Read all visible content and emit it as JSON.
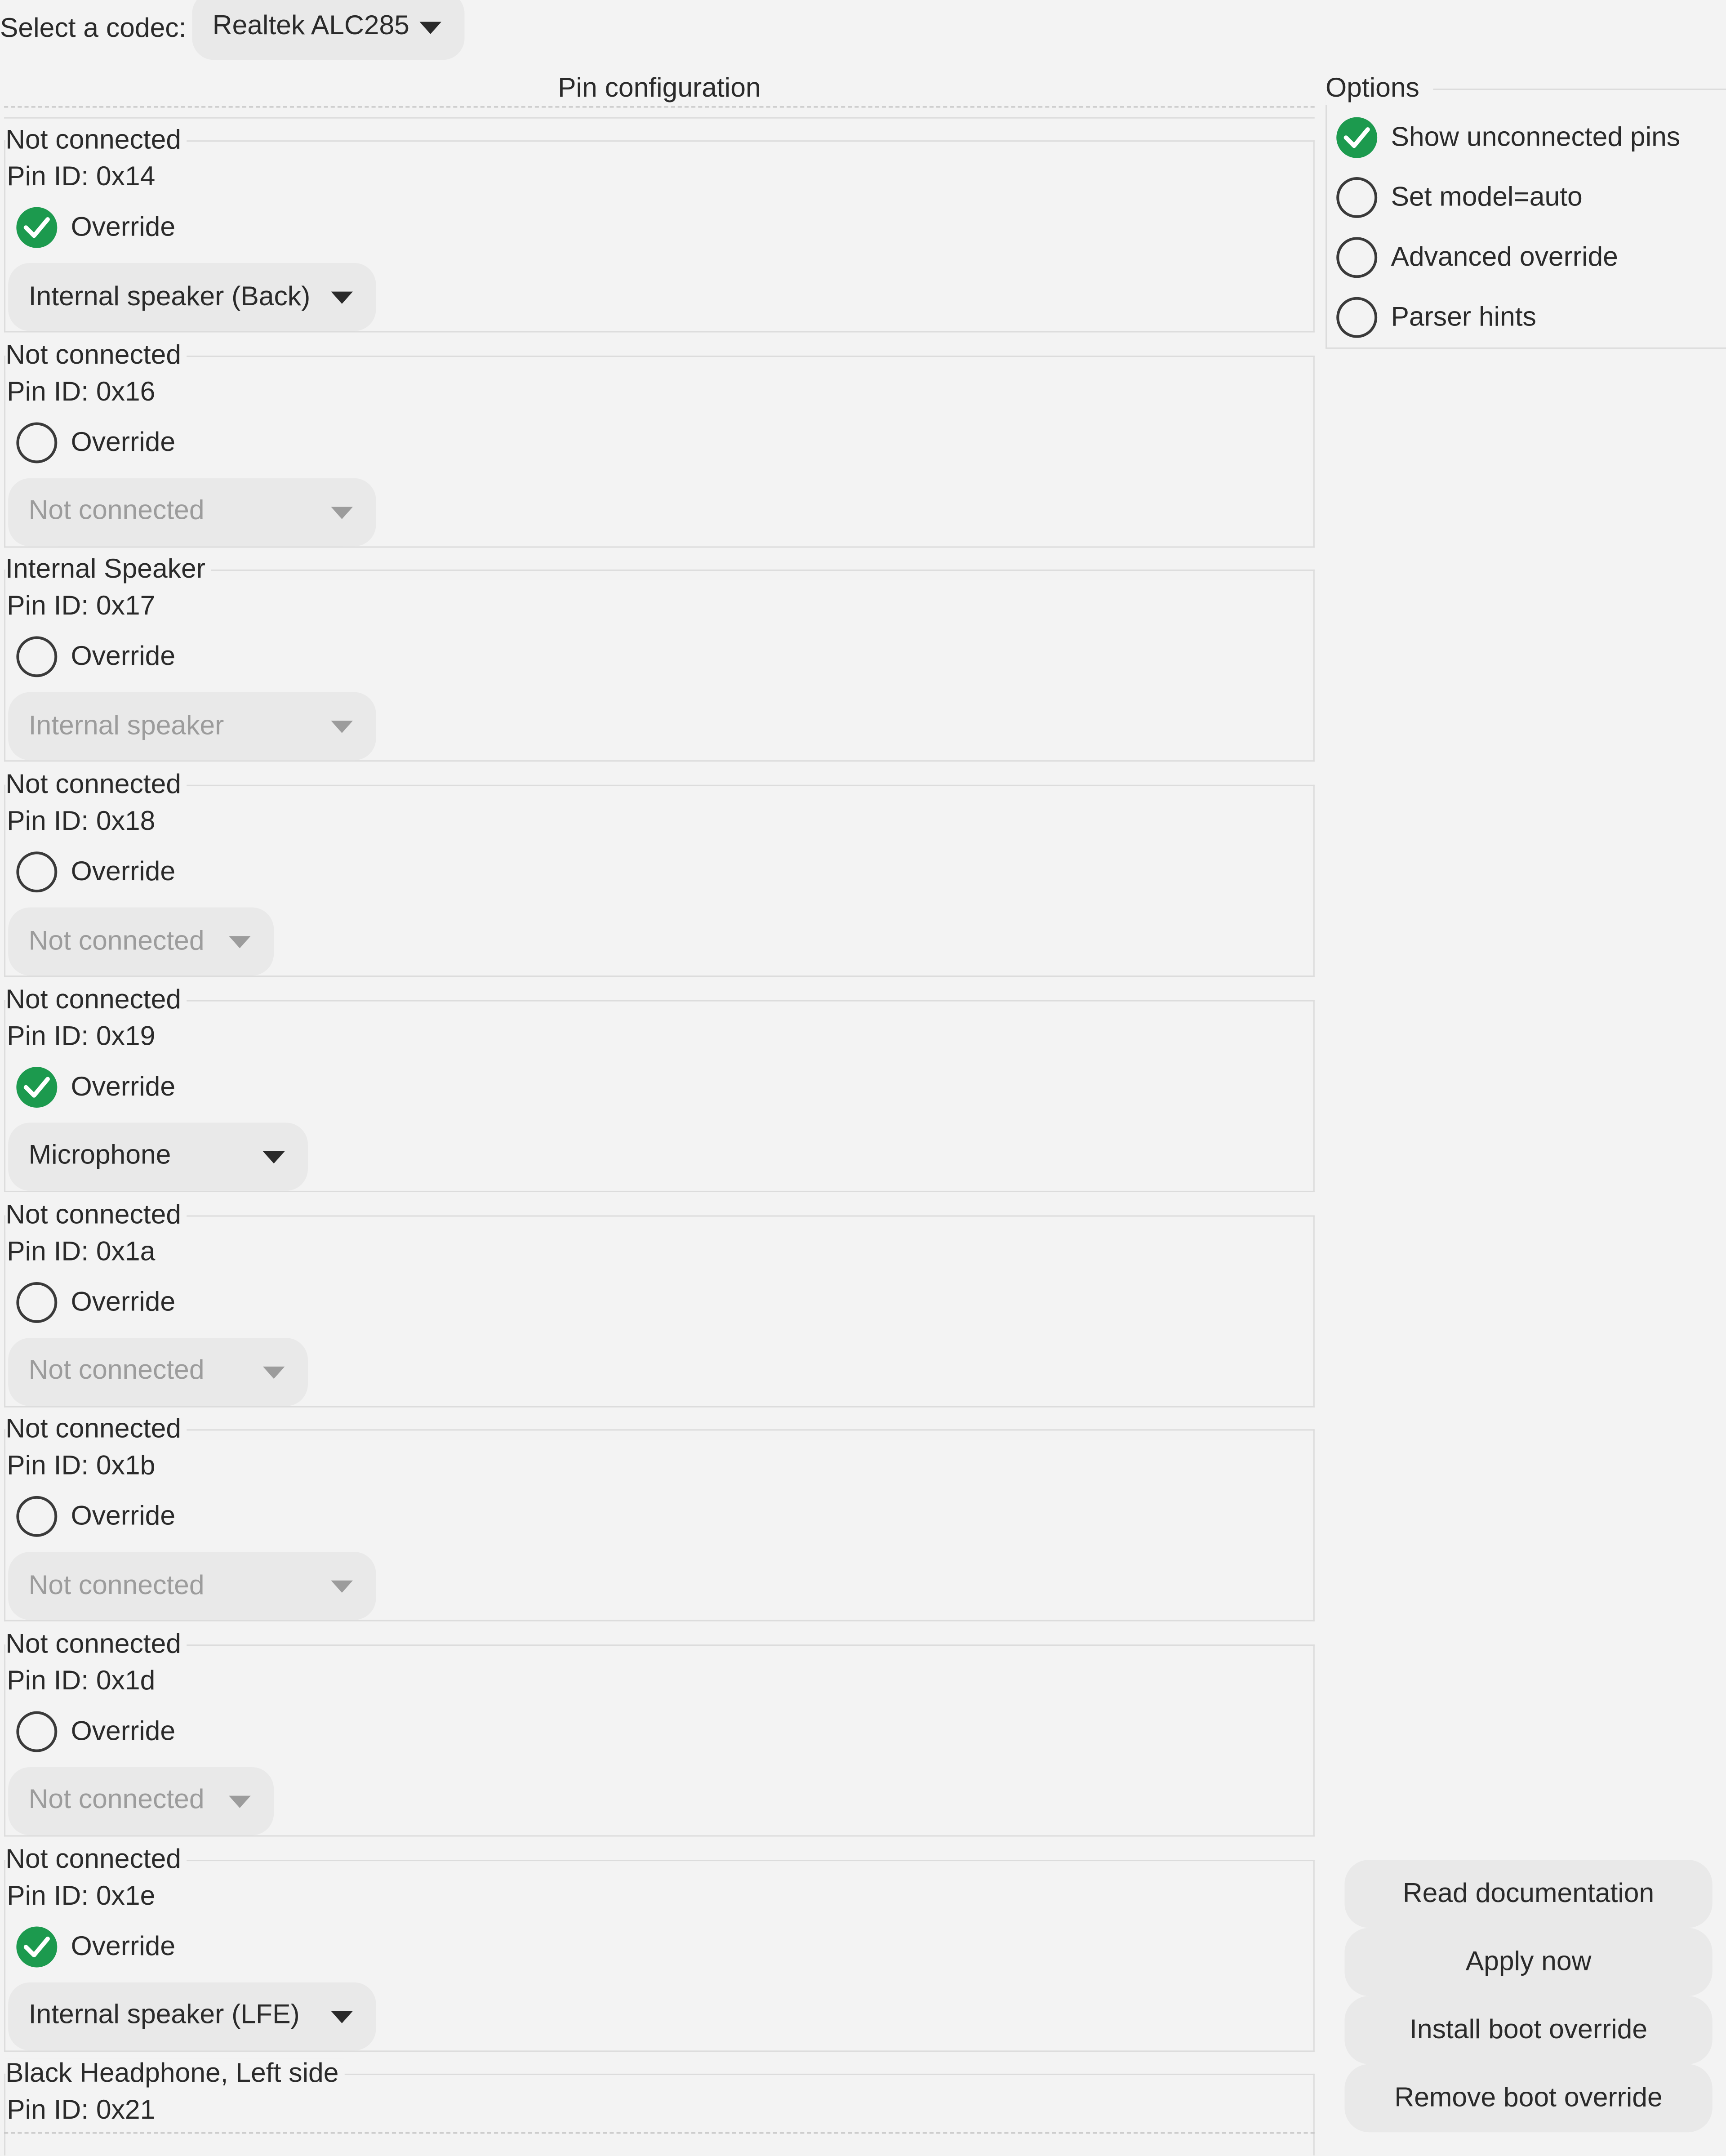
{
  "codec": {
    "label": "Select a codec:",
    "selected": "Realtek ALC285"
  },
  "pin_config": {
    "title": "Pin configuration",
    "pins": [
      {
        "connection": "Not connected",
        "pin_id": "Pin ID: 0x14",
        "override_label": "Override",
        "override": true,
        "type": "Internal speaker (Back)"
      },
      {
        "connection": "Not connected",
        "pin_id": "Pin ID: 0x16",
        "override_label": "Override",
        "override": false,
        "type": "Not connected"
      },
      {
        "connection": "Internal Speaker",
        "pin_id": "Pin ID: 0x17",
        "override_label": "Override",
        "override": false,
        "type": "Internal speaker"
      },
      {
        "connection": "Not connected",
        "pin_id": "Pin ID: 0x18",
        "override_label": "Override",
        "override": false,
        "type": "Not connected"
      },
      {
        "connection": "Not connected",
        "pin_id": "Pin ID: 0x19",
        "override_label": "Override",
        "override": true,
        "type": "Microphone"
      },
      {
        "connection": "Not connected",
        "pin_id": "Pin ID: 0x1a",
        "override_label": "Override",
        "override": false,
        "type": "Not connected"
      },
      {
        "connection": "Not connected",
        "pin_id": "Pin ID: 0x1b",
        "override_label": "Override",
        "override": false,
        "type": "Not connected"
      },
      {
        "connection": "Not connected",
        "pin_id": "Pin ID: 0x1d",
        "override_label": "Override",
        "override": false,
        "type": "Not connected"
      },
      {
        "connection": "Not connected",
        "pin_id": "Pin ID: 0x1e",
        "override_label": "Override",
        "override": true,
        "type": "Internal speaker (LFE)"
      },
      {
        "connection": "Black Headphone, Left side",
        "pin_id": "Pin ID: 0x21"
      }
    ]
  },
  "options": {
    "title": "Options",
    "items": [
      {
        "label": "Show unconnected pins",
        "checked": true
      },
      {
        "label": "Set model=auto",
        "checked": false
      },
      {
        "label": "Advanced override",
        "checked": false
      },
      {
        "label": "Parser hints",
        "checked": false
      }
    ]
  },
  "actions": {
    "read_docs": "Read documentation",
    "apply_now": "Apply now",
    "install_boot": "Install boot override",
    "remove_boot": "Remove boot override"
  },
  "colors": {
    "check_green": "#1c9a4e",
    "background": "#f3f3f3",
    "dropdown": "#e9e9e9"
  }
}
